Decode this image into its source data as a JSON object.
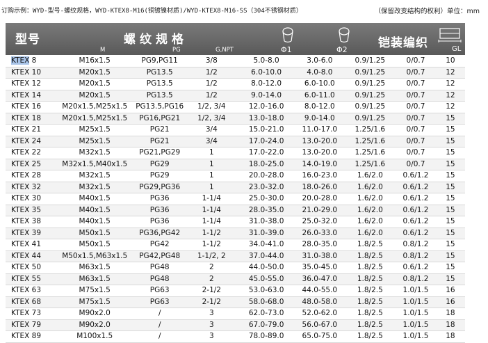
{
  "order_note": {
    "left": "订购示例：WYD-型号-螺纹规格，WYD-KTEX8-M16(铜镀镍材质)/WYD-KTEX8-M16-SS（304不锈钢材质）",
    "right": "（保留改变结构的权利）单位：mm"
  },
  "header": {
    "model": "型号",
    "thread_spec": "螺纹规格",
    "thread_sub_m": "M",
    "thread_sub_pg": "PG",
    "thread_sub_gnpt": "G,NPT",
    "phi1": "Φ1",
    "phi2": "Φ2",
    "armor_braid": "铠装编织",
    "gl": "GL"
  },
  "rows": [
    [
      "KTEX 8",
      "M16x1.5",
      "PG9,PG11",
      "3/8",
      "5.0-8.0",
      "3.0-6.0",
      "0.9/1.25",
      "0/0.7",
      "10"
    ],
    [
      "KTEX 10",
      "M20x1.5",
      "PG13.5",
      "1/2",
      "6.0-10.0",
      "4.0-8.0",
      "0.9/1.25",
      "0/0.7",
      "12"
    ],
    [
      "KTEX 12",
      "M20x1.5",
      "PG13.5",
      "1/2",
      "8.0-12.0",
      "6.0-10.0",
      "0.9/1.25",
      "0/0.7",
      "12"
    ],
    [
      "KTEX 14",
      "M20x1.5",
      "PG13.5",
      "1/2",
      "9.0-14.0",
      "6.0-11.0",
      "0.9/1.25",
      "0/0.7",
      "12"
    ],
    [
      "KTEX 16",
      "M20x1.5,M25x1.5",
      "PG13.5,PG16",
      "1/2, 3/4",
      "12.0-16.0",
      "8.0-12.0",
      "0.9/1.25",
      "0/0.7",
      "12"
    ],
    [
      "KTEX 18",
      "M20x1.5,M25x1.5",
      "PG16,PG21",
      "1/2, 3/4",
      "13.0-18.0",
      "9.0-14.0",
      "0.9/1.25",
      "0/0.7",
      "15"
    ],
    [
      "KTEX 21",
      "M25x1.5",
      "PG21",
      "3/4",
      "15.0-21.0",
      "11.0-17.0",
      "1.25/1.6",
      "0/0.7",
      "15"
    ],
    [
      "KTEX 24",
      "M25x1.5",
      "PG21",
      "3/4",
      "17.0-24.0",
      "13.0-20.0",
      "1.25/1.6",
      "0/0.7",
      "15"
    ],
    [
      "KTEX 22",
      "M32x1.5",
      "PG21,PG29",
      "1",
      "17.0-22.0",
      "13.0-20.0",
      "1.25/1.6",
      "0/0.7",
      "15"
    ],
    [
      "KTEX 25",
      "M32x1.5,M40x1.5",
      "PG29",
      "1",
      "18.0-25.0",
      "14.0-19.0",
      "1.25/1.6",
      "0/0.7",
      "15"
    ],
    [
      "KTEX 28",
      "M32x1.5",
      "PG29",
      "1",
      "20.0-28.0",
      "16.0-23.0",
      "1.6/2.0",
      "0.6/1.2",
      "15"
    ],
    [
      "KTEX 32",
      "M32x1.5",
      "PG29,PG36",
      "1",
      "23.0-32.0",
      "18.0-26.0",
      "1.6/2.0",
      "0.6/1.2",
      "15"
    ],
    [
      "KTEX 30",
      "M40x1.5",
      "PG36",
      "1-1/4",
      "25.0-30.0",
      "20.0-28.0",
      "1.6/2.0",
      "0.6/1.2",
      "15"
    ],
    [
      "KTEX 35",
      "M40x1.5",
      "PG36",
      "1-1/4",
      "28.0-35.0",
      "21.0-29.0",
      "1.6/2.0",
      "0.6/1.2",
      "15"
    ],
    [
      "KTEX 38",
      "M40x1.5",
      "PG36",
      "1-1/4",
      "31.0-38.0",
      "25.0-32.0",
      "1.6/2.0",
      "0.6/1.2",
      "15"
    ],
    [
      "KTEX 39",
      "M50x1.5",
      "PG36,PG42",
      "1-1/2",
      "31.0-39.0",
      "26.0-33.0",
      "1.6/2.0",
      "0.6/1.2",
      "15"
    ],
    [
      "KTEX 41",
      "M50x1.5",
      "PG42",
      "1-1/2",
      "34.0-41.0",
      "28.0-35.0",
      "1.8/2.5",
      "0.8/1.2",
      "15"
    ],
    [
      "KTEX 44",
      "M50x1.5,M63x1.5",
      "PG42,PG48",
      "1-1/2, 2",
      "37.0-44.0",
      "31.0-38.0",
      "1.8/2.5",
      "0.8/1.2",
      "15"
    ],
    [
      "KTEX 50",
      "M63x1.5",
      "PG48",
      "2",
      "44.0-50.0",
      "35.0-45.0",
      "1.8/2.5",
      "0.6/1.2",
      "15"
    ],
    [
      "KTEX 55",
      "M63x1.5",
      "PG48",
      "2",
      "45.0-55.0",
      "36.0-47.0",
      "1.8/2.5",
      "0.8/1.2",
      "15"
    ],
    [
      "KTEX 63",
      "M75x1.5",
      "PG63",
      "2-1/2",
      "53.0-63.0",
      "44.0-55.0",
      "1.8/2.5",
      "1.0/1.5",
      "16"
    ],
    [
      "KTEX 68",
      "M75x1.5",
      "PG63",
      "2-1/2",
      "58.0-68.0",
      "48.0-58.0",
      "1.8/2.5",
      "1.0/1.5",
      "16"
    ],
    [
      "KTEX 73",
      "M90x2.0",
      "/",
      "3",
      "62.0-73.0",
      "52.0-62.0",
      "1.8/2.5",
      "1.0/1.5",
      "18"
    ],
    [
      "KTEX 79",
      "M90x2.0",
      "/",
      "3",
      "67.0-79.0",
      "56.0-67.0",
      "1.8/2.5",
      "1.0/1.5",
      "18"
    ],
    [
      "KTEX 89",
      "M100x1.5",
      "/",
      "3",
      "78.0-89.0",
      "65.0-75.0",
      "1.8/2.5",
      "1.0/1.5",
      "18"
    ]
  ]
}
